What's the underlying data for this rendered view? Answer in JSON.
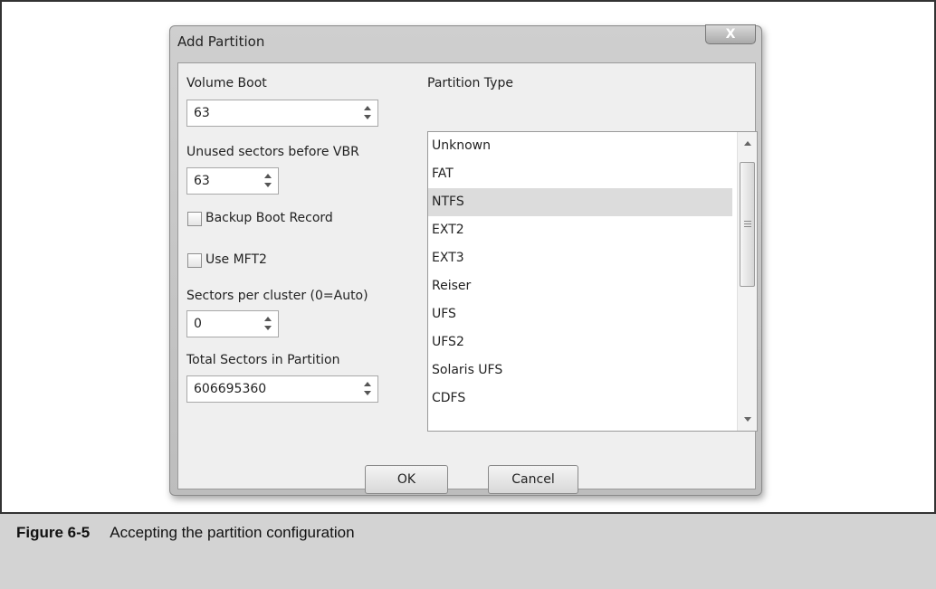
{
  "dialog": {
    "title": "Add Partition",
    "close_label": "X"
  },
  "volume_boot": {
    "label": "Volume Boot",
    "value": "63"
  },
  "unused_sectors": {
    "label": "Unused sectors before VBR",
    "value": "63"
  },
  "backup_boot_record": {
    "label": "Backup Boot Record",
    "checked": false
  },
  "use_mft2": {
    "label": "Use MFT2",
    "checked": false
  },
  "sectors_per_cluster": {
    "label": "Sectors per cluster (0=Auto)",
    "value": "0"
  },
  "total_sectors": {
    "label": "Total Sectors in Partition",
    "value": "606695360"
  },
  "partition_type": {
    "label": "Partition Type",
    "selected": "NTFS",
    "items": [
      "Unknown",
      "FAT",
      "NTFS",
      "EXT2",
      "EXT3",
      "Reiser",
      "UFS",
      "UFS2",
      "Solaris UFS",
      "CDFS"
    ]
  },
  "buttons": {
    "ok": "OK",
    "cancel": "Cancel"
  },
  "figure": {
    "number": "Figure 6-5",
    "caption": "Accepting the partition configuration"
  }
}
